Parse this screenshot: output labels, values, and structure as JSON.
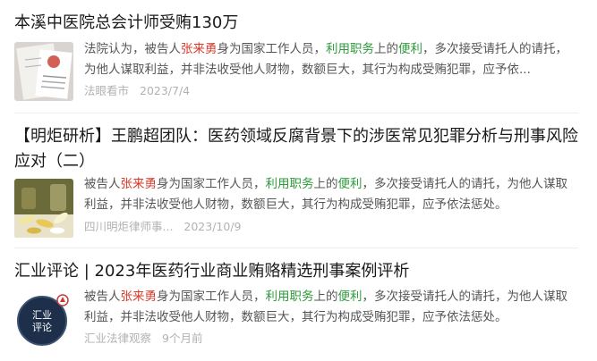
{
  "results": [
    {
      "title": "本溪中医院总会计师受贿130万",
      "snippet": [
        {
          "t": "法院认为，被告人"
        },
        {
          "t": "张来勇",
          "c": "red"
        },
        {
          "t": "身为国家工作人员，"
        },
        {
          "t": "利用职务",
          "c": "green"
        },
        {
          "t": "上的"
        },
        {
          "t": "便利",
          "c": "green"
        },
        {
          "t": "，多次接受请托人的请托，为他人谋取利益，并非法收受他人财物，数额巨大，其行为构成受贿犯罪，应予依..."
        }
      ],
      "source": "法眼看市",
      "date": "2023/7/4"
    },
    {
      "title": "【明炬研析】王鹏超团队：医药领域反腐背景下的涉医常见犯罪分析与刑事风险应对（二）",
      "snippet": [
        {
          "t": "被告人"
        },
        {
          "t": "张来勇",
          "c": "red"
        },
        {
          "t": "身为国家工作人员，"
        },
        {
          "t": "利用职务",
          "c": "green"
        },
        {
          "t": "上的"
        },
        {
          "t": "便利",
          "c": "green"
        },
        {
          "t": "，多次接受请托人的请托，为他人谋取利益，并非法收受他人财物，数额巨大，其行为构成受贿犯罪，应予依法惩处。"
        }
      ],
      "source": "四川明炬律师事...",
      "date": "2023/10/9"
    },
    {
      "title": "汇业评论 | 2023年医药行业商业贿赂精选刑事案例评析",
      "snippet": [
        {
          "t": "被告人"
        },
        {
          "t": "张来勇",
          "c": "red"
        },
        {
          "t": "身为国家工作人员，"
        },
        {
          "t": "利用职务",
          "c": "green"
        },
        {
          "t": "上的"
        },
        {
          "t": "便利",
          "c": "green"
        },
        {
          "t": "，多次接受请托人的请托，为他人谋取利益，并非法收受他人财物，数额巨大，其行为构成受贿犯罪，应予依法惩处。"
        }
      ],
      "source": "汇业法律观察",
      "date": "9个月前",
      "thumb_text": [
        "汇业",
        "评论"
      ]
    }
  ],
  "colors": {
    "highlight_name": "#d83a2b",
    "highlight_term": "#2f9a3c",
    "meta": "#b2b2b2"
  }
}
